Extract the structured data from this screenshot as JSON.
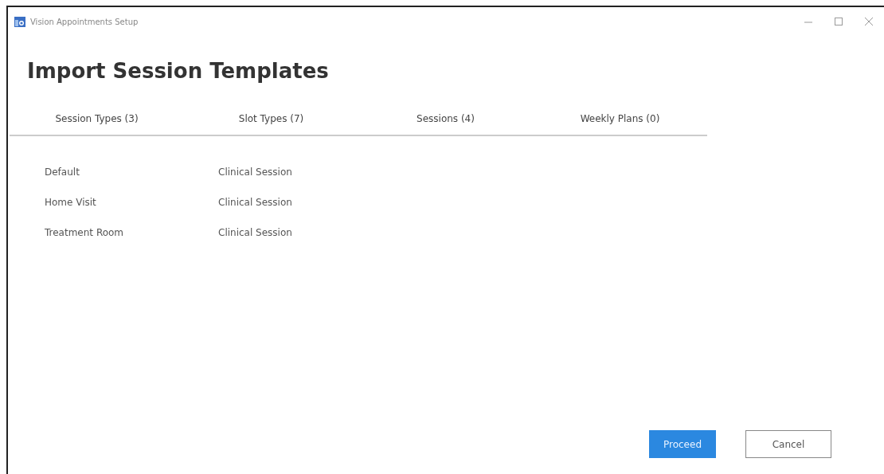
{
  "window": {
    "title": "Vision Appointments Setup"
  },
  "heading": "Import Session Templates",
  "tabs": [
    {
      "label": "Session Types (3)"
    },
    {
      "label": "Slot Types (7)"
    },
    {
      "label": "Sessions (4)"
    },
    {
      "label": "Weekly Plans (0)"
    }
  ],
  "rows": [
    {
      "name": "Default",
      "type": "Clinical Session"
    },
    {
      "name": "Home Visit",
      "type": "Clinical Session"
    },
    {
      "name": "Treatment Room",
      "type": "Clinical Session"
    }
  ],
  "buttons": [
    {
      "label": "Proceed",
      "kind": "primary"
    },
    {
      "label": "Cancel",
      "kind": "secondary"
    }
  ]
}
